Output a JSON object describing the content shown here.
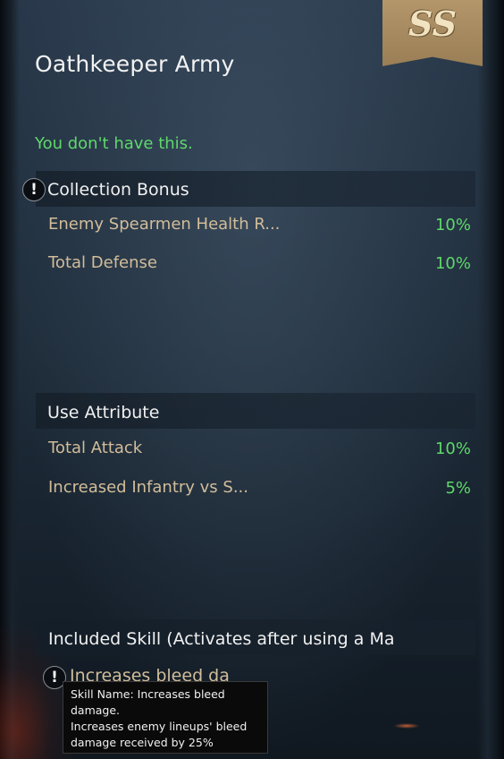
{
  "badge": {
    "grade": "SS"
  },
  "title": "Oathkeeper Army",
  "status": "You don't have this.",
  "collection_bonus": {
    "label": "Collection Bonus",
    "rows": [
      {
        "name": "Enemy Spearmen Health R...",
        "value": "10%"
      },
      {
        "name": "Total Defense",
        "value": "10%"
      }
    ]
  },
  "use_attribute": {
    "label": "Use Attribute",
    "rows": [
      {
        "name": "Total Attack",
        "value": "10%"
      },
      {
        "name": "Increased Infantry vs S...",
        "value": "5%"
      }
    ]
  },
  "included_skill": {
    "label": "Included Skill (Activates after using a Ma",
    "skill_name": "Increases bleed da",
    "tooltip": "Skill Name: Increases bleed\ndamage.\nIncreases enemy lineups' bleed\n damage received by 25%"
  },
  "colors": {
    "positive": "#5fd86b",
    "label": "#d2bd9a",
    "badge": "#b3966a"
  },
  "icons": {
    "info": "!"
  }
}
